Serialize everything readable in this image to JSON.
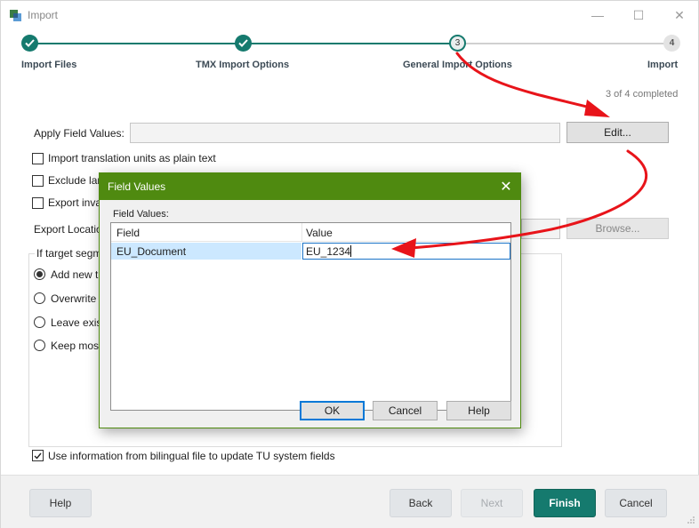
{
  "window": {
    "title": "Import",
    "controls": {
      "minimize": "—",
      "maximize": "☐",
      "close": "✕"
    }
  },
  "stepper": {
    "steps": [
      {
        "number": "1",
        "label": "Import Files",
        "state": "done"
      },
      {
        "number": "2",
        "label": "TMX Import Options",
        "state": "done"
      },
      {
        "number": "3",
        "label": "General Import Options",
        "state": "current"
      },
      {
        "number": "4",
        "label": "Import",
        "state": "todo"
      }
    ],
    "progress": "3 of 4 completed",
    "accent_color": "#157a6e"
  },
  "form": {
    "apply_field_values_label": "Apply Field Values:",
    "apply_field_values_value": "",
    "edit_button": "Edit...",
    "checkboxes": [
      {
        "label": "Import translation units as plain text",
        "checked": false
      },
      {
        "label": "Exclude lan",
        "checked": false
      },
      {
        "label": "Export inva",
        "checked": false
      }
    ],
    "export_location_label": "Export Locatio",
    "browse_button": "Browse...",
    "group_title": "If target segm",
    "radios": [
      {
        "label": "Add new tr",
        "selected": true
      },
      {
        "label": "Overwrite e",
        "selected": false
      },
      {
        "label": "Leave exist",
        "selected": false
      },
      {
        "label": "Keep most",
        "selected": false
      }
    ],
    "bilingual_checkbox": {
      "label": "Use information from bilingual file to update TU system fields",
      "checked": true
    }
  },
  "footer": {
    "help": "Help",
    "back": "Back",
    "next": "Next",
    "finish": "Finish",
    "cancel": "Cancel"
  },
  "dialog": {
    "title": "Field Values",
    "close": "✕",
    "list_label": "Field Values:",
    "columns": [
      "Field",
      "Value"
    ],
    "rows": [
      {
        "field": "EU_Document",
        "value": "EU_1234"
      }
    ],
    "ok": "OK",
    "cancel": "Cancel",
    "help": "Help",
    "title_color": "#4f8a10"
  },
  "annotation": {
    "arrow_color": "#e8141a"
  }
}
